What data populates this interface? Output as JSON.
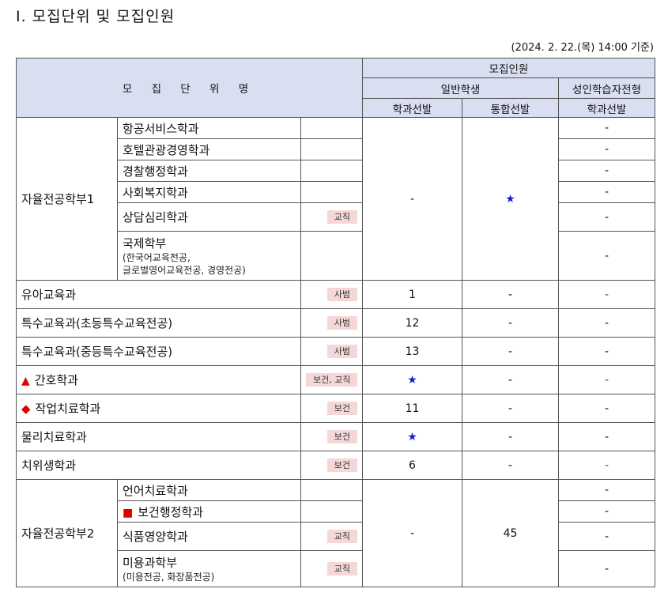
{
  "title": "Ⅰ. 모집단위 및 모집인원",
  "timestamp": "(2024. 2. 22.(목) 14:00 기준)",
  "header": {
    "unit_name": "모 집 단 위 명",
    "quota": "모집인원",
    "general": "일반학생",
    "adult": "성인학습자전형",
    "dept_select": "학과선발",
    "integrated_select": "통합선발",
    "adult_dept_select": "학과선발"
  },
  "group1": {
    "name": "자율전공학부1",
    "dept_value": "-",
    "integrated_value": "★",
    "rows": [
      {
        "name": "항공서비스학과",
        "tag": "",
        "adult": "-"
      },
      {
        "name": "호텔관광경영학과",
        "tag": "",
        "adult": "-"
      },
      {
        "name": "경찰행정학과",
        "tag": "",
        "adult": "-"
      },
      {
        "name": "사회복지학과",
        "tag": "",
        "adult": "-"
      },
      {
        "name": "상담심리학과",
        "tag": "교직",
        "adult": "-"
      },
      {
        "name": "국제학부",
        "sub1": "(한국어교육전공,",
        "sub2": "글로벌영어교육전공, 경영전공)",
        "tag": "",
        "adult": "-"
      }
    ]
  },
  "singles": [
    {
      "name": "유아교육과",
      "tag": "사범",
      "dept": "1",
      "integrated": "-",
      "adult": "-"
    },
    {
      "name": "특수교육과(초등특수교육전공)",
      "tag": "사범",
      "dept": "12",
      "integrated": "-",
      "adult": "-"
    },
    {
      "name": "특수교육과(중등특수교육전공)",
      "tag": "사범",
      "dept": "13",
      "integrated": "-",
      "adult": "-"
    },
    {
      "name": "간호학과",
      "marker": "▲",
      "tag": "보건, 교직",
      "dept": "★",
      "integrated": "-",
      "adult": "-"
    },
    {
      "name": "작업치료학과",
      "marker": "◆",
      "tag": "보건",
      "dept": "11",
      "integrated": "-",
      "adult": "-"
    },
    {
      "name": "물리치료학과",
      "tag": "보건",
      "dept": "★",
      "integrated": "-",
      "adult": "-"
    },
    {
      "name": "치위생학과",
      "tag": "보건",
      "dept": "6",
      "integrated": "-",
      "adult": "-"
    }
  ],
  "group2": {
    "name": "자율전공학부2",
    "dept_value": "-",
    "integrated_value": "45",
    "rows": [
      {
        "name": "언어치료학과",
        "tag": "",
        "adult": "-"
      },
      {
        "name": "보건행정학과",
        "marker": "■",
        "tag": "",
        "adult": "-"
      },
      {
        "name": "식품영양학과",
        "tag": "교직",
        "adult": "-"
      },
      {
        "name": "미용과학부",
        "sub1": "(미용전공, 화장품전공)",
        "tag": "교직",
        "adult": "-"
      }
    ]
  },
  "colors": {
    "header_bg": "#d9def0",
    "tag_bg": "#f6d7d8",
    "star": "#1a1ad4",
    "marker_red": "#e00000",
    "dash_blue": "#2a40d0"
  }
}
